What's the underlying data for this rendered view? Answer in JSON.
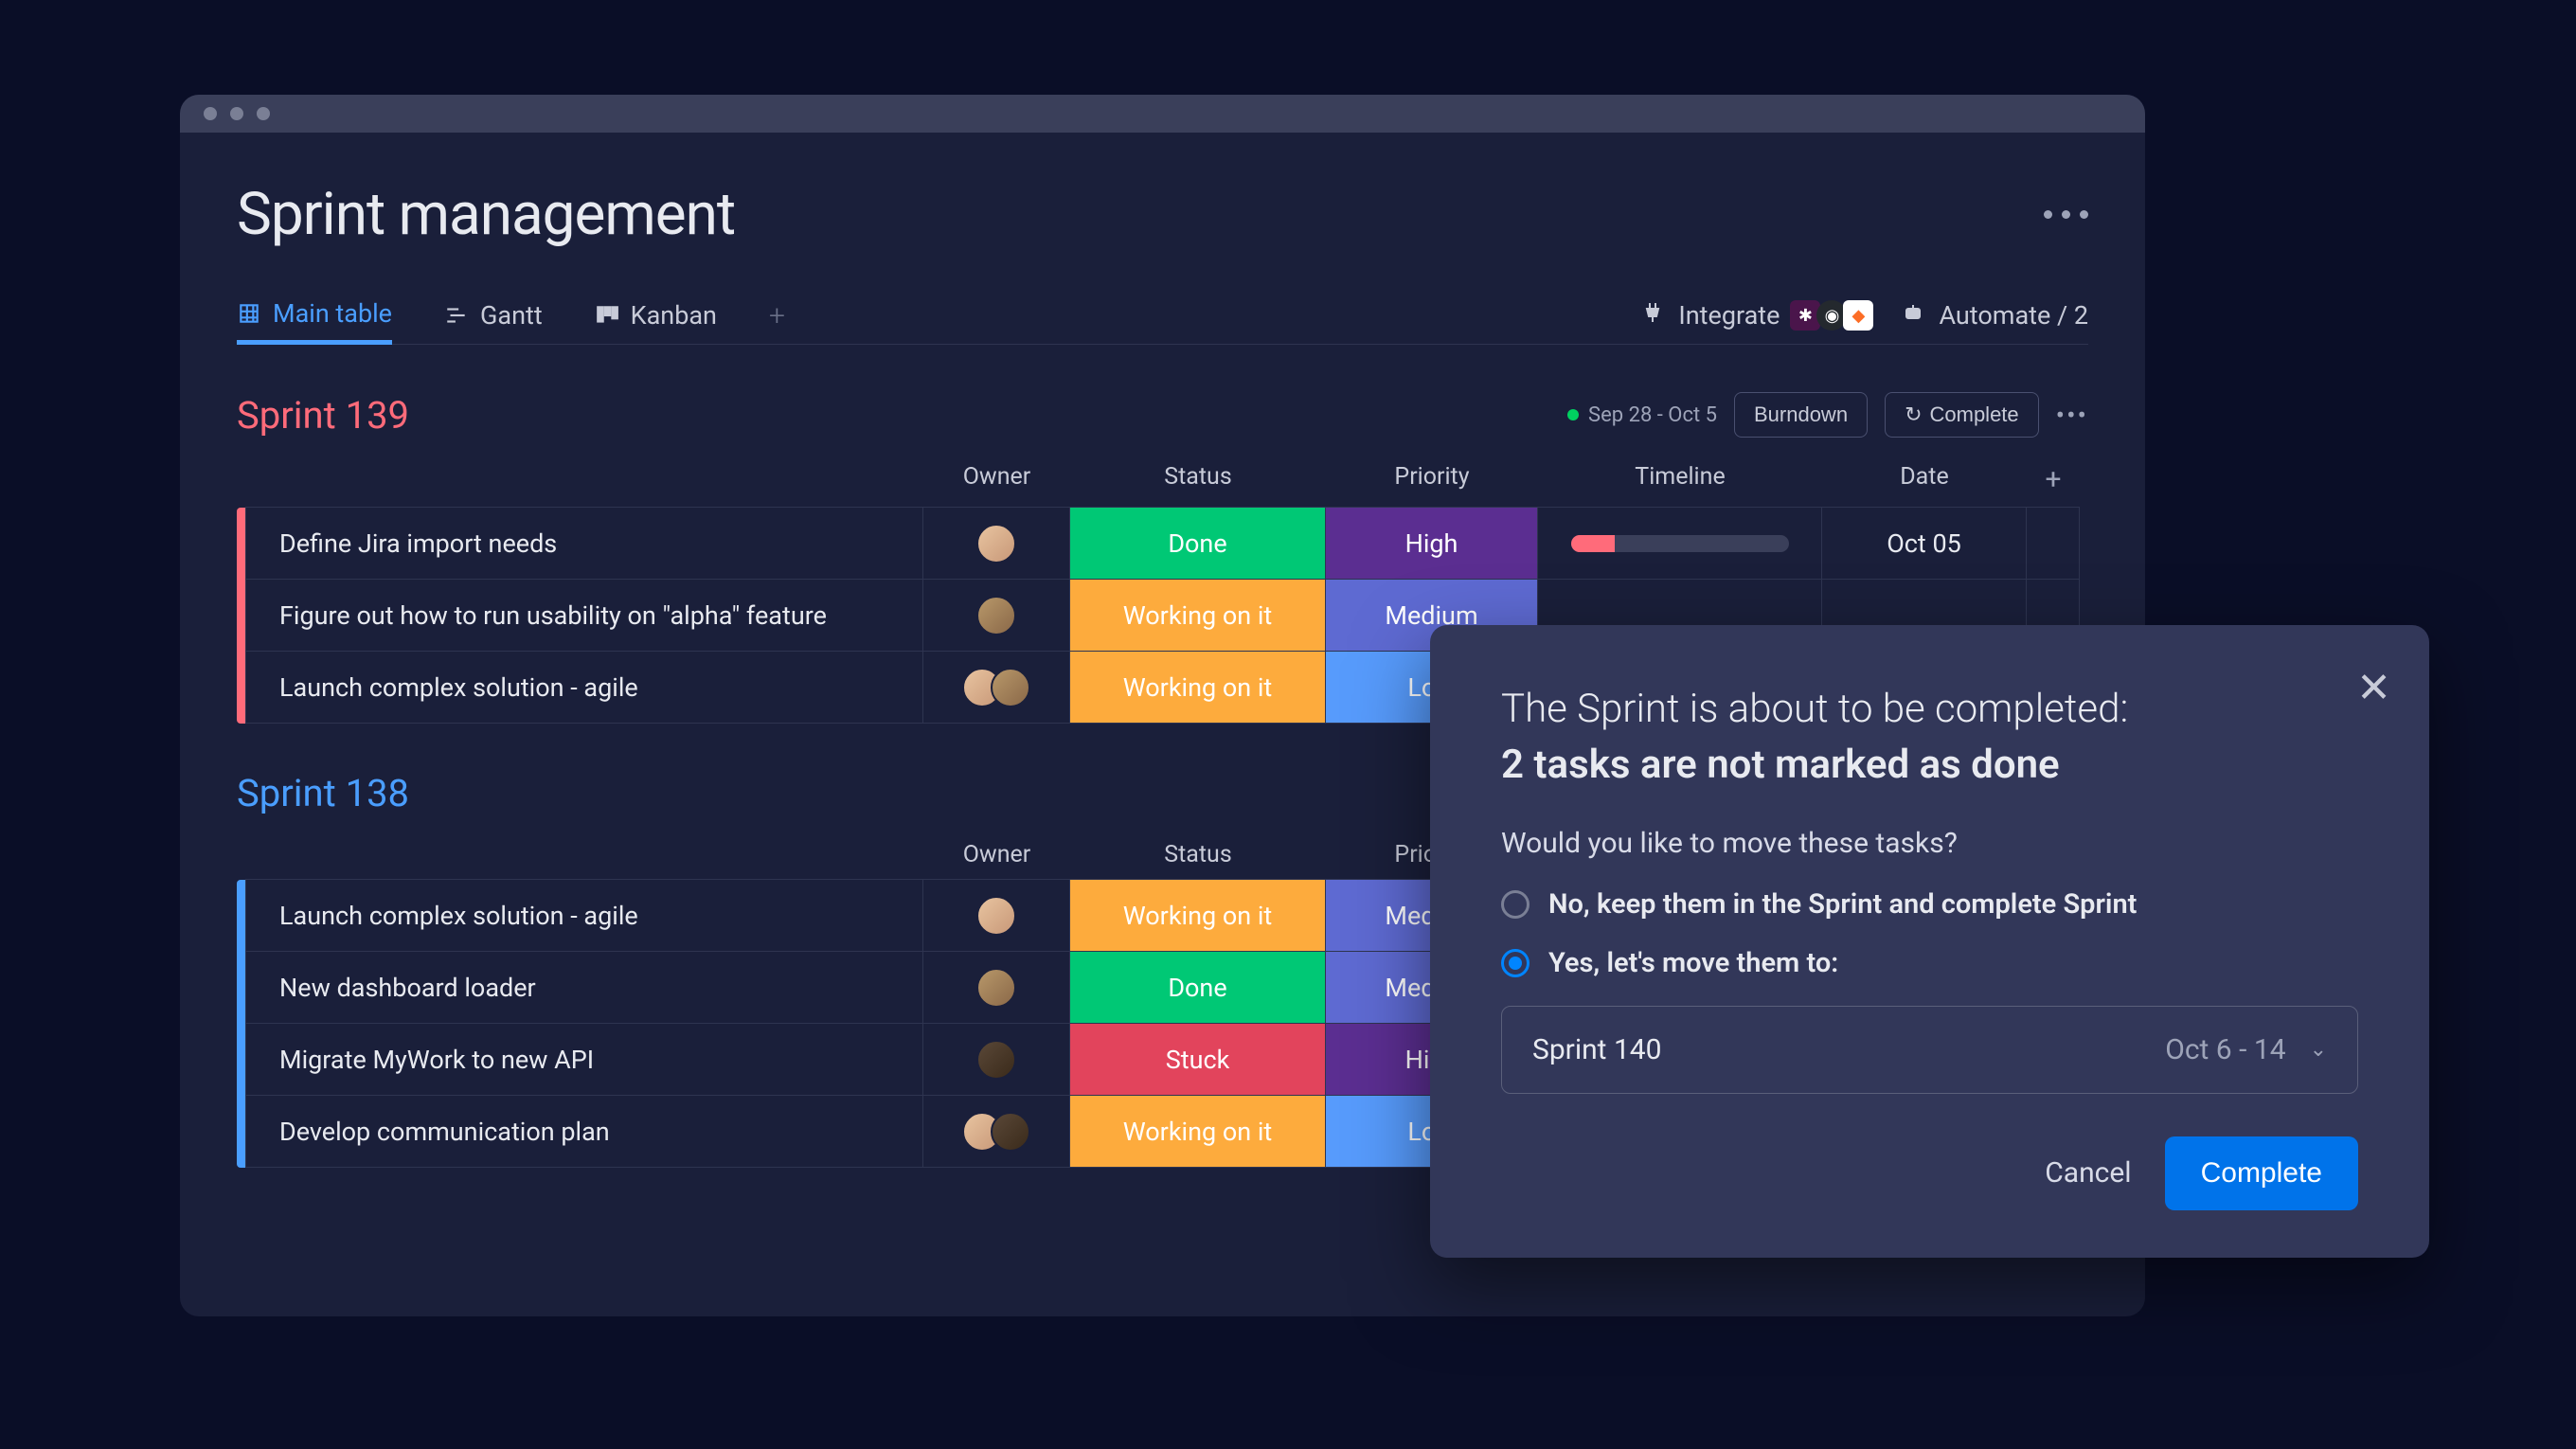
{
  "page_title": "Sprint management",
  "tabs": {
    "main_table": "Main table",
    "gantt": "Gantt",
    "kanban": "Kanban"
  },
  "toolbar": {
    "integrate": "Integrate",
    "automate": "Automate / 2"
  },
  "sprints": [
    {
      "title": "Sprint 139",
      "date_range": "Sep 28 - Oct 5",
      "burndown_label": "Burndown",
      "complete_label": "Complete",
      "columns": {
        "owner": "Owner",
        "status": "Status",
        "priority": "Priority",
        "timeline": "Timeline",
        "date": "Date"
      },
      "rows": [
        {
          "name": "Define Jira import needs",
          "status": "Done",
          "priority": "High",
          "date": "Oct 05",
          "timeline_pct": 20,
          "owners": 1
        },
        {
          "name": "Figure out how to run usability on \"alpha\" feature",
          "status": "Working on it",
          "priority": "Medium",
          "owners": 1
        },
        {
          "name": "Launch complex solution - agile",
          "status": "Working on it",
          "priority": "Low",
          "owners": 2
        }
      ]
    },
    {
      "title": "Sprint 138",
      "columns": {
        "owner": "Owner",
        "status": "Status",
        "priority": "Priority"
      },
      "rows": [
        {
          "name": "Launch complex solution - agile",
          "status": "Working on it",
          "priority": "Medium",
          "owners": 1
        },
        {
          "name": "New dashboard loader",
          "status": "Done",
          "priority": "Medium",
          "owners": 1
        },
        {
          "name": "Migrate MyWork to new API",
          "status": "Stuck",
          "priority": "High",
          "owners": 1
        },
        {
          "name": "Develop communication plan",
          "status": "Working on it",
          "priority": "Low",
          "owners": 2
        }
      ]
    }
  ],
  "modal": {
    "line1": "The Sprint is about to be completed:",
    "line2": "2 tasks are not marked as done",
    "question": "Would you like to move these tasks?",
    "option_no": "No, keep them in the Sprint and complete Sprint",
    "option_yes": "Yes, let's move them to:",
    "select_value": "Sprint 140",
    "select_date": "Oct 6 - 14",
    "cancel": "Cancel",
    "complete": "Complete"
  },
  "status_colors": {
    "Done": "#00c875",
    "Working on it": "#fdab3d",
    "Stuck": "#e2445c"
  },
  "priority_colors": {
    "High": "#5b2e91",
    "Medium": "#5e6ad2",
    "Low": "#579bfc"
  }
}
